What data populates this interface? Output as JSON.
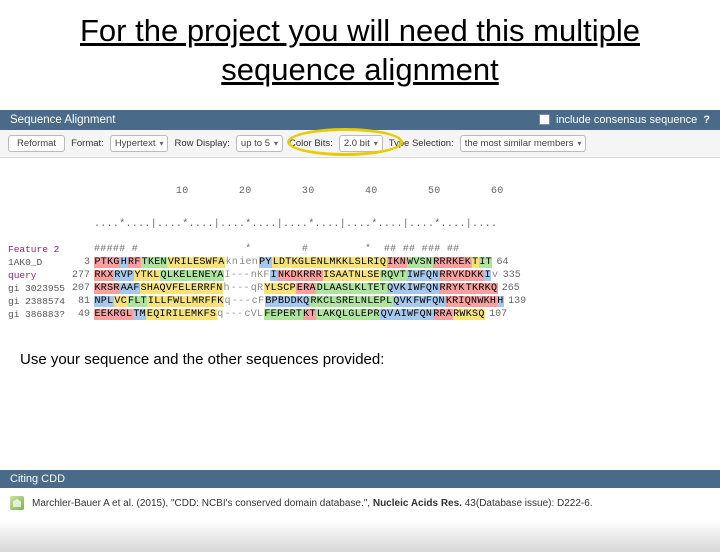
{
  "title": "For the project you will need this multiple sequence alignment",
  "panel": {
    "title": "Sequence Alignment",
    "consensus_label": "include consensus sequence",
    "help": "?"
  },
  "toolbar": {
    "reformat": "Reformat",
    "format_label": "Format:",
    "format_value": "Hypertext",
    "row_label": "Row Display:",
    "row_value": "up to 5",
    "color_label": "Color Bits:",
    "color_value": "2.0 bit",
    "type_label": "Type Selection:",
    "type_value": "the most similar members"
  },
  "ruler_numbers": "             10        20        30        40        50        60",
  "ruler_ticks": "....*....|....*....|....*....|....*....|....*....|....*....|....",
  "alignment": {
    "feature": {
      "label": "Feature 2",
      "start": "",
      "seq": "##### #                 *        #         *  ## ## ### ## ",
      "end": ""
    },
    "rows": [
      {
        "label": "1AK0_D",
        "start": "3",
        "end": "64",
        "spans": [
          {
            "t": "PTKG",
            "c": "c-r"
          },
          {
            "t": "H",
            "c": "c-b"
          },
          {
            "t": "RF",
            "c": "c-r"
          },
          {
            "t": "TKEN",
            "c": "c-g"
          },
          {
            "t": "VRILESWFA",
            "c": "c-y"
          },
          {
            "t": "kn",
            "c": "c-lc"
          },
          {
            "t": "ien",
            "c": "c-lc"
          },
          {
            "t": "PY",
            "c": "c-b"
          },
          {
            "t": "LDTKGLENLMKKLSLRIQ",
            "c": "c-y"
          },
          {
            "t": "IKN",
            "c": "c-r"
          },
          {
            "t": "WVSN",
            "c": "c-g"
          },
          {
            "t": "RRRKEK",
            "c": "c-r"
          },
          {
            "t": "T",
            "c": "c-y"
          },
          {
            "t": "IT",
            "c": "c-g"
          }
        ]
      },
      {
        "label": "query",
        "start": "277",
        "end": "335",
        "spans": [
          {
            "t": "RKX",
            "c": "c-r"
          },
          {
            "t": "RVP",
            "c": "c-b"
          },
          {
            "t": "YTKL",
            "c": "c-y"
          },
          {
            "t": "QLKELENEYA",
            "c": "c-g"
          },
          {
            "t": "I---",
            "c": "c-dash"
          },
          {
            "t": "nKF",
            "c": "c-lc"
          },
          {
            "t": "I",
            "c": "c-b"
          },
          {
            "t": "NKDKRRR",
            "c": "c-r"
          },
          {
            "t": "ISAATNLSE",
            "c": "c-y"
          },
          {
            "t": "RQVT",
            "c": "c-g"
          },
          {
            "t": "IWFQN",
            "c": "c-b"
          },
          {
            "t": "RRVKDKK",
            "c": "c-r"
          },
          {
            "t": "I",
            "c": "c-b"
          },
          {
            "t": "v",
            "c": "c-lc"
          }
        ]
      },
      {
        "label": "gi 3023955",
        "start": "207",
        "end": "265",
        "spans": [
          {
            "t": "KRSR",
            "c": "c-r"
          },
          {
            "t": "AAF",
            "c": "c-b"
          },
          {
            "t": "SHAQVFELERRFN",
            "c": "c-y"
          },
          {
            "t": "h",
            "c": "c-lc"
          },
          {
            "t": "---",
            "c": "c-dash"
          },
          {
            "t": "qR",
            "c": "c-lc"
          },
          {
            "t": "YLSCP",
            "c": "c-y"
          },
          {
            "t": "ERA",
            "c": "c-r"
          },
          {
            "t": "DLAASLKLTET",
            "c": "c-g"
          },
          {
            "t": "QVK",
            "c": "c-b"
          },
          {
            "t": "IWFQN",
            "c": "c-b"
          },
          {
            "t": "RRYK",
            "c": "c-r"
          },
          {
            "t": "TKRKQ",
            "c": "c-r"
          }
        ]
      },
      {
        "label": "gi 2388574",
        "start": "81",
        "end": "139",
        "spans": [
          {
            "t": "NPL",
            "c": "c-b"
          },
          {
            "t": "VC",
            "c": "c-y"
          },
          {
            "t": "FLT",
            "c": "c-g"
          },
          {
            "t": "ILLFWLLMRFFK",
            "c": "c-y"
          },
          {
            "t": "q",
            "c": "c-lc"
          },
          {
            "t": "---",
            "c": "c-dash"
          },
          {
            "t": "cF",
            "c": "c-lc"
          },
          {
            "t": "BPBDDKQ",
            "c": "c-b"
          },
          {
            "t": "RKCLSRELNLEPL",
            "c": "c-g"
          },
          {
            "t": "QVK",
            "c": "c-b"
          },
          {
            "t": "FWFQN",
            "c": "c-b"
          },
          {
            "t": "KRIQNWKH",
            "c": "c-r"
          },
          {
            "t": "H",
            "c": "c-b"
          }
        ]
      },
      {
        "label": "gi 386883?",
        "start": "49",
        "end": "107",
        "spans": [
          {
            "t": "EEKRGL",
            "c": "c-r"
          },
          {
            "t": "TM",
            "c": "c-b"
          },
          {
            "t": "EQIRILEMKFS",
            "c": "c-y"
          },
          {
            "t": "q",
            "c": "c-lc"
          },
          {
            "t": "---",
            "c": "c-dash"
          },
          {
            "t": "cVL",
            "c": "c-lc"
          },
          {
            "t": "FEPERT",
            "c": "c-g"
          },
          {
            "t": "KT",
            "c": "c-r"
          },
          {
            "t": "LAKQLGLEPR",
            "c": "c-g"
          },
          {
            "t": "QV",
            "c": "c-b"
          },
          {
            "t": "AIWFQN",
            "c": "c-b"
          },
          {
            "t": "RRA",
            "c": "c-r"
          },
          {
            "t": "RWKSQ",
            "c": "c-y"
          }
        ]
      }
    ]
  },
  "instruction": "Use your sequence and the other sequences provided:",
  "citing": {
    "header": "Citing CDD",
    "text_prefix": "Marchler-Bauer A et al. (2015), \"CDD: NCBI's conserved domain database.\", ",
    "journal": "Nucleic Acids Res.",
    "text_suffix": " 43(Database issue): D222-6."
  }
}
